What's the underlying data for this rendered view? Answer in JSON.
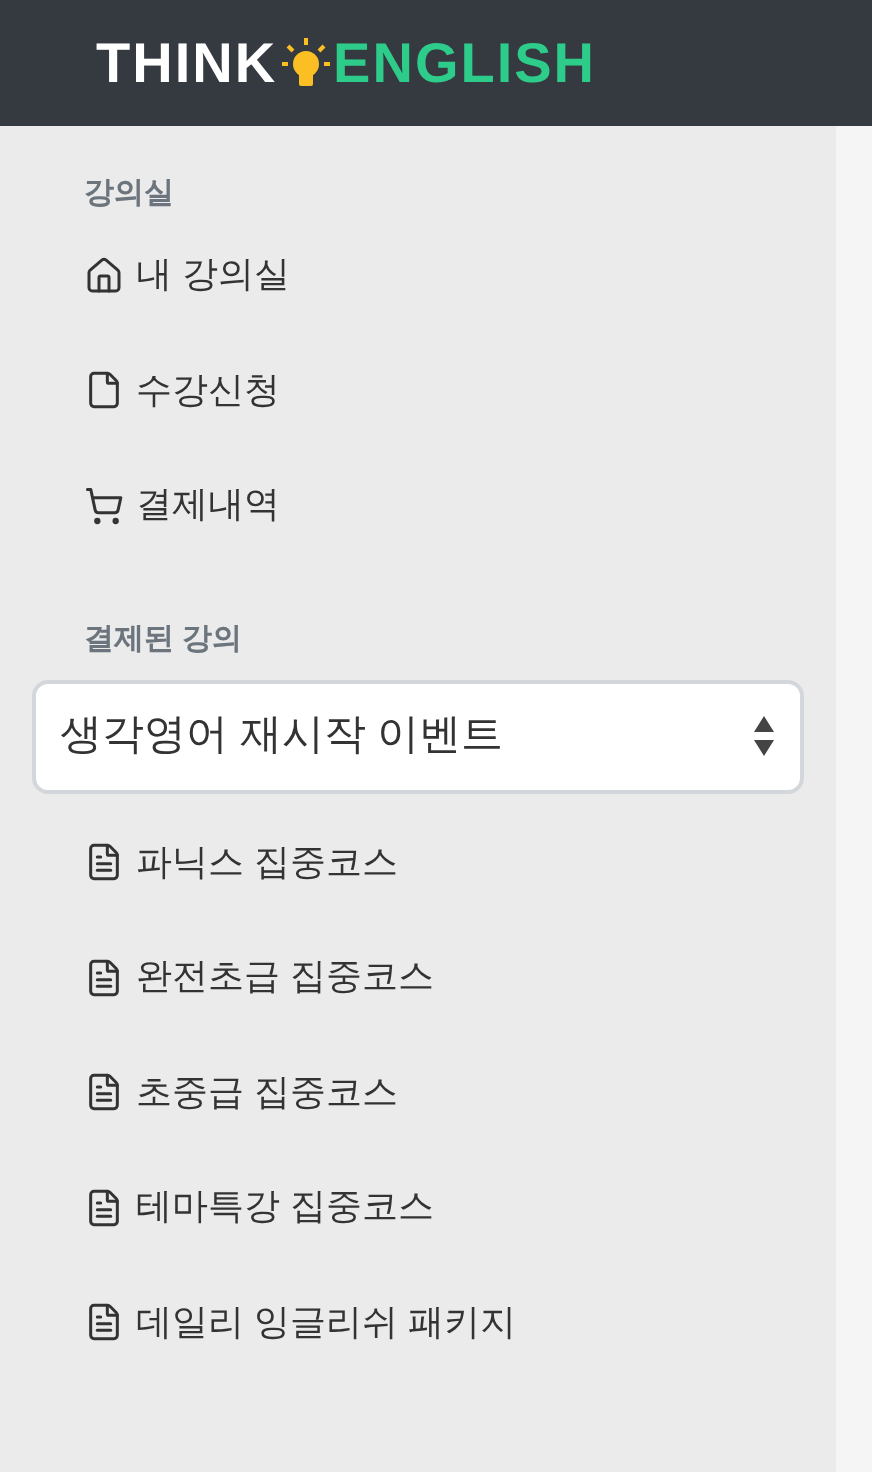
{
  "header": {
    "logo": {
      "left": "THINK",
      "right": "ENGLISH"
    }
  },
  "sidebar": {
    "sections": [
      {
        "heading": "강의실",
        "items": [
          {
            "label": "내 강의실",
            "kind": "home"
          },
          {
            "label": "수강신청",
            "kind": "page"
          },
          {
            "label": "결제내역",
            "kind": "cart"
          }
        ]
      },
      {
        "heading": "결제된 강의",
        "select": {
          "value": "생각영어 재시작 이벤트"
        },
        "items": [
          {
            "label": "파닉스 집중코스",
            "kind": "course"
          },
          {
            "label": "완전초급 집중코스",
            "kind": "course"
          },
          {
            "label": "초중급 집중코스",
            "kind": "course"
          },
          {
            "label": "테마특강 집중코스",
            "kind": "course"
          },
          {
            "label": "데일리 잉글리쉬 패키지",
            "kind": "course"
          }
        ]
      }
    ]
  }
}
